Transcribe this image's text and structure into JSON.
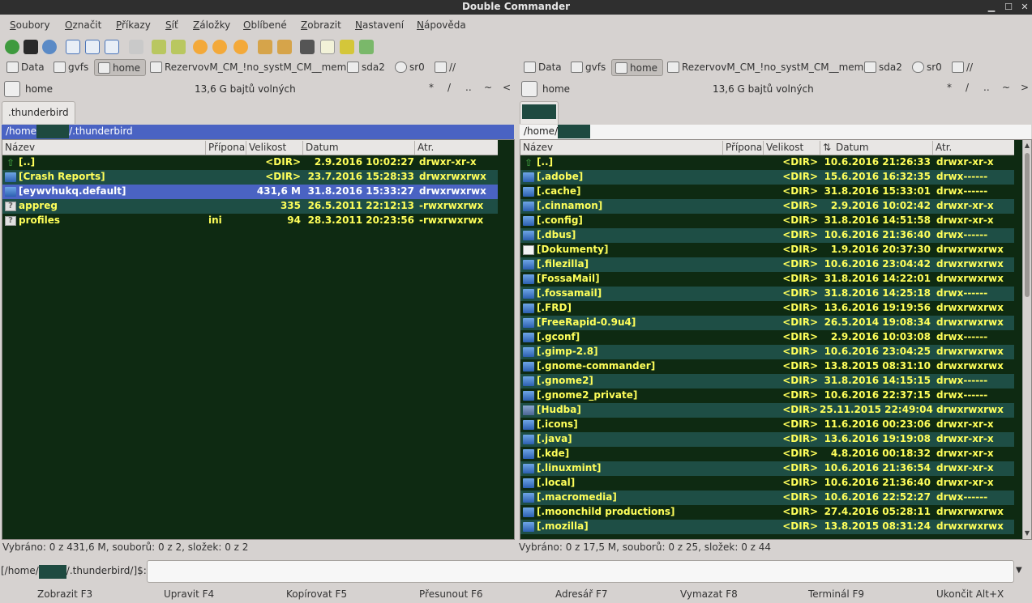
{
  "window": {
    "title": "Double Commander"
  },
  "menu": [
    "Soubory",
    "Označit",
    "Příkazy",
    "Síť",
    "Záložky",
    "Oblíbené",
    "Zobrazit",
    "Nastavení",
    "Nápověda"
  ],
  "drives": [
    "Data",
    "gvfs",
    "home",
    "RezervovM_CM_!no_systM_CM__mem",
    "sda2",
    "sr0",
    "//"
  ],
  "left": {
    "path_label": "home",
    "free": "13,6 G bajtů volných",
    "nav": [
      "*",
      "/",
      "..",
      "~",
      "<"
    ],
    "tab": ".thunderbird",
    "current_path_prefix": "/home",
    "current_path_suffix": "/.thunderbird",
    "columns": [
      "Název",
      "Přípona",
      "Velikost",
      "Datum",
      "Atr."
    ],
    "rows": [
      {
        "name": "[..]",
        "ext": "",
        "size": "<DIR>",
        "date": "2.9.2016 10:02:27",
        "attr": "drwxr-xr-x",
        "icon": "up-icon"
      },
      {
        "name": "[Crash Reports]",
        "ext": "",
        "size": "<DIR>",
        "date": "23.7.2016 15:28:33",
        "attr": "drwxrwxrwx",
        "icon": "folder-icon"
      },
      {
        "name": "[eywvhukq.default]",
        "ext": "",
        "size": "431,6 M",
        "date": "31.8.2016 15:33:27",
        "attr": "drwxrwxrwx",
        "icon": "folder-icon"
      },
      {
        "name": "appreg",
        "ext": "",
        "size": "335",
        "date": "26.5.2011 22:12:13",
        "attr": "-rwxrwxrwx",
        "icon": "unknown-file-icon"
      },
      {
        "name": "profiles",
        "ext": "ini",
        "size": "94",
        "date": "28.3.2011 20:23:56",
        "attr": "-rwxrwxrwx",
        "icon": "unknown-file-icon"
      }
    ],
    "status": "Vybráno: 0 z 431,6 M, souborů: 0 z 2, složek: 0 z 2"
  },
  "right": {
    "path_label": "home",
    "free": "13,6 G bajtů volných",
    "nav": [
      "*",
      "/",
      "..",
      "~",
      ">"
    ],
    "current_path_prefix": "/home/",
    "columns": [
      "Název",
      "Přípona",
      "Velikost",
      "Datum",
      "Atr."
    ],
    "rows": [
      {
        "name": "[..]",
        "size": "<DIR>",
        "date": "10.6.2016 21:26:33",
        "attr": "drwxr-xr-x",
        "icon": "up-icon"
      },
      {
        "name": "[.adobe]",
        "size": "<DIR>",
        "date": "15.6.2016 16:32:35",
        "attr": "drwx------",
        "icon": "folder-icon"
      },
      {
        "name": "[.cache]",
        "size": "<DIR>",
        "date": "31.8.2016 15:33:01",
        "attr": "drwx------",
        "icon": "folder-icon"
      },
      {
        "name": "[.cinnamon]",
        "size": "<DIR>",
        "date": "2.9.2016 10:02:42",
        "attr": "drwxr-xr-x",
        "icon": "folder-icon"
      },
      {
        "name": "[.config]",
        "size": "<DIR>",
        "date": "31.8.2016 14:51:58",
        "attr": "drwxr-xr-x",
        "icon": "folder-icon"
      },
      {
        "name": "[.dbus]",
        "size": "<DIR>",
        "date": "10.6.2016 21:36:40",
        "attr": "drwx------",
        "icon": "folder-icon"
      },
      {
        "name": "[Dokumenty]",
        "size": "<DIR>",
        "date": "1.9.2016 20:37:30",
        "attr": "drwxrwxrwx",
        "icon": "document-folder-icon"
      },
      {
        "name": "[.filezilla]",
        "size": "<DIR>",
        "date": "10.6.2016 23:04:42",
        "attr": "drwxrwxrwx",
        "icon": "folder-icon"
      },
      {
        "name": "[FossaMail]",
        "size": "<DIR>",
        "date": "31.8.2016 14:22:01",
        "attr": "drwxrwxrwx",
        "icon": "folder-icon"
      },
      {
        "name": "[.fossamail]",
        "size": "<DIR>",
        "date": "31.8.2016 14:25:18",
        "attr": "drwx------",
        "icon": "folder-icon"
      },
      {
        "name": "[.FRD]",
        "size": "<DIR>",
        "date": "13.6.2016 19:19:56",
        "attr": "drwxrwxrwx",
        "icon": "folder-icon"
      },
      {
        "name": "[FreeRapid-0.9u4]",
        "size": "<DIR>",
        "date": "26.5.2014 19:08:34",
        "attr": "drwxrwxrwx",
        "icon": "folder-icon"
      },
      {
        "name": "[.gconf]",
        "size": "<DIR>",
        "date": "2.9.2016 10:03:08",
        "attr": "drwx------",
        "icon": "folder-icon"
      },
      {
        "name": "[.gimp-2.8]",
        "size": "<DIR>",
        "date": "10.6.2016 23:04:25",
        "attr": "drwxrwxrwx",
        "icon": "folder-icon"
      },
      {
        "name": "[.gnome-commander]",
        "size": "<DIR>",
        "date": "13.8.2015 08:31:10",
        "attr": "drwxrwxrwx",
        "icon": "folder-icon"
      },
      {
        "name": "[.gnome2]",
        "size": "<DIR>",
        "date": "31.8.2016 14:15:15",
        "attr": "drwx------",
        "icon": "folder-icon"
      },
      {
        "name": "[.gnome2_private]",
        "size": "<DIR>",
        "date": "10.6.2016 22:37:15",
        "attr": "drwx------",
        "icon": "folder-icon"
      },
      {
        "name": "[Hudba]",
        "size": "<DIR>",
        "date": "25.11.2015 22:49:04",
        "attr": "drwxrwxrwx",
        "icon": "music-folder-icon"
      },
      {
        "name": "[.icons]",
        "size": "<DIR>",
        "date": "11.6.2016 00:23:06",
        "attr": "drwxr-xr-x",
        "icon": "folder-icon"
      },
      {
        "name": "[.java]",
        "size": "<DIR>",
        "date": "13.6.2016 19:19:08",
        "attr": "drwxr-xr-x",
        "icon": "folder-icon"
      },
      {
        "name": "[.kde]",
        "size": "<DIR>",
        "date": "4.8.2016 00:18:32",
        "attr": "drwxr-xr-x",
        "icon": "folder-icon"
      },
      {
        "name": "[.linuxmint]",
        "size": "<DIR>",
        "date": "10.6.2016 21:36:54",
        "attr": "drwxr-xr-x",
        "icon": "folder-icon"
      },
      {
        "name": "[.local]",
        "size": "<DIR>",
        "date": "10.6.2016 21:36:40",
        "attr": "drwxr-xr-x",
        "icon": "folder-icon"
      },
      {
        "name": "[.macromedia]",
        "size": "<DIR>",
        "date": "10.6.2016 22:52:27",
        "attr": "drwx------",
        "icon": "folder-icon"
      },
      {
        "name": "[.moonchild productions]",
        "size": "<DIR>",
        "date": "27.4.2016 05:28:11",
        "attr": "drwxrwxrwx",
        "icon": "folder-icon"
      },
      {
        "name": "[.mozilla]",
        "size": "<DIR>",
        "date": "13.8.2015 08:31:24",
        "attr": "drwxrwxrwx",
        "icon": "folder-icon"
      }
    ],
    "status": "Vybráno: 0 z 17,5 M, souborů: 0 z 25, složek: 0 z 44"
  },
  "cmdline": {
    "prompt_prefix": "[/home/",
    "prompt_suffix": "/.thunderbird/]$:",
    "value": ""
  },
  "fkeys": [
    "Zobrazit F3",
    "Upravit F4",
    "Kopírovat F5",
    "Přesunout F6",
    "Adresář F7",
    "Vymazat F8",
    "Terminál F9",
    "Ukončit Alt+X"
  ],
  "colors": {
    "list_bg": "#0e2a12",
    "row_alt": "#1e4e45",
    "row_text": "#ffff5a",
    "selection": "#4a63c3"
  }
}
